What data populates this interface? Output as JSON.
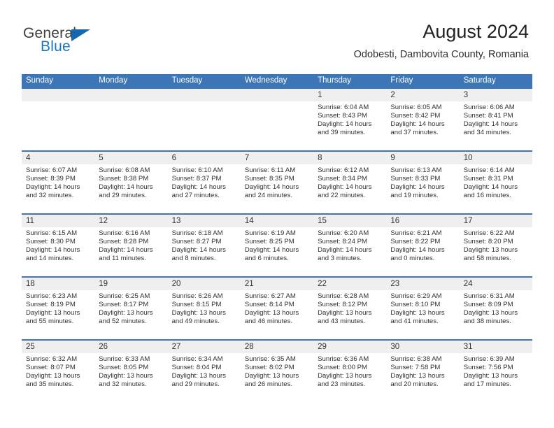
{
  "brand": {
    "name_part1": "General",
    "name_part2": "Blue",
    "accent_color": "#1567b0"
  },
  "header": {
    "title": "August 2024",
    "subtitle": "Odobesti, Dambovita County, Romania"
  },
  "calendar": {
    "header_color": "#3d76b6",
    "date_band_color": "#efefef",
    "weekday_labels": [
      "Sunday",
      "Monday",
      "Tuesday",
      "Wednesday",
      "Thursday",
      "Friday",
      "Saturday"
    ],
    "weeks": [
      [
        {
          "day": "",
          "sunrise": "",
          "sunset": "",
          "daylight": ""
        },
        {
          "day": "",
          "sunrise": "",
          "sunset": "",
          "daylight": ""
        },
        {
          "day": "",
          "sunrise": "",
          "sunset": "",
          "daylight": ""
        },
        {
          "day": "",
          "sunrise": "",
          "sunset": "",
          "daylight": ""
        },
        {
          "day": "1",
          "sunrise": "Sunrise: 6:04 AM",
          "sunset": "Sunset: 8:43 PM",
          "daylight": "Daylight: 14 hours and 39 minutes."
        },
        {
          "day": "2",
          "sunrise": "Sunrise: 6:05 AM",
          "sunset": "Sunset: 8:42 PM",
          "daylight": "Daylight: 14 hours and 37 minutes."
        },
        {
          "day": "3",
          "sunrise": "Sunrise: 6:06 AM",
          "sunset": "Sunset: 8:41 PM",
          "daylight": "Daylight: 14 hours and 34 minutes."
        }
      ],
      [
        {
          "day": "4",
          "sunrise": "Sunrise: 6:07 AM",
          "sunset": "Sunset: 8:39 PM",
          "daylight": "Daylight: 14 hours and 32 minutes."
        },
        {
          "day": "5",
          "sunrise": "Sunrise: 6:08 AM",
          "sunset": "Sunset: 8:38 PM",
          "daylight": "Daylight: 14 hours and 29 minutes."
        },
        {
          "day": "6",
          "sunrise": "Sunrise: 6:10 AM",
          "sunset": "Sunset: 8:37 PM",
          "daylight": "Daylight: 14 hours and 27 minutes."
        },
        {
          "day": "7",
          "sunrise": "Sunrise: 6:11 AM",
          "sunset": "Sunset: 8:35 PM",
          "daylight": "Daylight: 14 hours and 24 minutes."
        },
        {
          "day": "8",
          "sunrise": "Sunrise: 6:12 AM",
          "sunset": "Sunset: 8:34 PM",
          "daylight": "Daylight: 14 hours and 22 minutes."
        },
        {
          "day": "9",
          "sunrise": "Sunrise: 6:13 AM",
          "sunset": "Sunset: 8:33 PM",
          "daylight": "Daylight: 14 hours and 19 minutes."
        },
        {
          "day": "10",
          "sunrise": "Sunrise: 6:14 AM",
          "sunset": "Sunset: 8:31 PM",
          "daylight": "Daylight: 14 hours and 16 minutes."
        }
      ],
      [
        {
          "day": "11",
          "sunrise": "Sunrise: 6:15 AM",
          "sunset": "Sunset: 8:30 PM",
          "daylight": "Daylight: 14 hours and 14 minutes."
        },
        {
          "day": "12",
          "sunrise": "Sunrise: 6:16 AM",
          "sunset": "Sunset: 8:28 PM",
          "daylight": "Daylight: 14 hours and 11 minutes."
        },
        {
          "day": "13",
          "sunrise": "Sunrise: 6:18 AM",
          "sunset": "Sunset: 8:27 PM",
          "daylight": "Daylight: 14 hours and 8 minutes."
        },
        {
          "day": "14",
          "sunrise": "Sunrise: 6:19 AM",
          "sunset": "Sunset: 8:25 PM",
          "daylight": "Daylight: 14 hours and 6 minutes."
        },
        {
          "day": "15",
          "sunrise": "Sunrise: 6:20 AM",
          "sunset": "Sunset: 8:24 PM",
          "daylight": "Daylight: 14 hours and 3 minutes."
        },
        {
          "day": "16",
          "sunrise": "Sunrise: 6:21 AM",
          "sunset": "Sunset: 8:22 PM",
          "daylight": "Daylight: 14 hours and 0 minutes."
        },
        {
          "day": "17",
          "sunrise": "Sunrise: 6:22 AM",
          "sunset": "Sunset: 8:20 PM",
          "daylight": "Daylight: 13 hours and 58 minutes."
        }
      ],
      [
        {
          "day": "18",
          "sunrise": "Sunrise: 6:23 AM",
          "sunset": "Sunset: 8:19 PM",
          "daylight": "Daylight: 13 hours and 55 minutes."
        },
        {
          "day": "19",
          "sunrise": "Sunrise: 6:25 AM",
          "sunset": "Sunset: 8:17 PM",
          "daylight": "Daylight: 13 hours and 52 minutes."
        },
        {
          "day": "20",
          "sunrise": "Sunrise: 6:26 AM",
          "sunset": "Sunset: 8:15 PM",
          "daylight": "Daylight: 13 hours and 49 minutes."
        },
        {
          "day": "21",
          "sunrise": "Sunrise: 6:27 AM",
          "sunset": "Sunset: 8:14 PM",
          "daylight": "Daylight: 13 hours and 46 minutes."
        },
        {
          "day": "22",
          "sunrise": "Sunrise: 6:28 AM",
          "sunset": "Sunset: 8:12 PM",
          "daylight": "Daylight: 13 hours and 43 minutes."
        },
        {
          "day": "23",
          "sunrise": "Sunrise: 6:29 AM",
          "sunset": "Sunset: 8:10 PM",
          "daylight": "Daylight: 13 hours and 41 minutes."
        },
        {
          "day": "24",
          "sunrise": "Sunrise: 6:31 AM",
          "sunset": "Sunset: 8:09 PM",
          "daylight": "Daylight: 13 hours and 38 minutes."
        }
      ],
      [
        {
          "day": "25",
          "sunrise": "Sunrise: 6:32 AM",
          "sunset": "Sunset: 8:07 PM",
          "daylight": "Daylight: 13 hours and 35 minutes."
        },
        {
          "day": "26",
          "sunrise": "Sunrise: 6:33 AM",
          "sunset": "Sunset: 8:05 PM",
          "daylight": "Daylight: 13 hours and 32 minutes."
        },
        {
          "day": "27",
          "sunrise": "Sunrise: 6:34 AM",
          "sunset": "Sunset: 8:04 PM",
          "daylight": "Daylight: 13 hours and 29 minutes."
        },
        {
          "day": "28",
          "sunrise": "Sunrise: 6:35 AM",
          "sunset": "Sunset: 8:02 PM",
          "daylight": "Daylight: 13 hours and 26 minutes."
        },
        {
          "day": "29",
          "sunrise": "Sunrise: 6:36 AM",
          "sunset": "Sunset: 8:00 PM",
          "daylight": "Daylight: 13 hours and 23 minutes."
        },
        {
          "day": "30",
          "sunrise": "Sunrise: 6:38 AM",
          "sunset": "Sunset: 7:58 PM",
          "daylight": "Daylight: 13 hours and 20 minutes."
        },
        {
          "day": "31",
          "sunrise": "Sunrise: 6:39 AM",
          "sunset": "Sunset: 7:56 PM",
          "daylight": "Daylight: 13 hours and 17 minutes."
        }
      ]
    ]
  }
}
